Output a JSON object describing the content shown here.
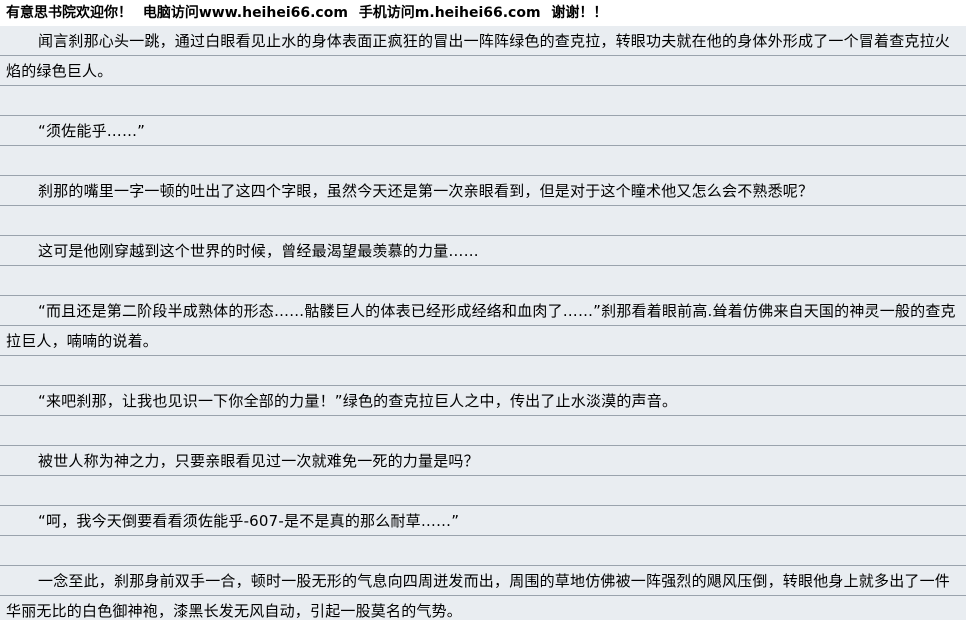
{
  "header": {
    "welcome": "有意思书院欢迎你！",
    "pc_visit": "电脑访问www.heihei66.com",
    "mobile_visit": "手机访问m.heihei66.com",
    "thanks": "谢谢！！"
  },
  "content": {
    "paragraphs": [
      "闻言刹那心头一跳，通过白眼看见止水的身体表面正疯狂的冒出一阵阵绿色的查克拉，转眼功夫就在他的身体外形成了一个冒着查克拉火焰的绿色巨人。",
      "“须佐能乎……”",
      "刹那的嘴里一字一顿的吐出了这四个字眼，虽然今天还是第一次亲眼看到，但是对于这个瞳术他又怎么会不熟悉呢？",
      "这可是他刚穿越到这个世界的时候，曾经最渴望最羡慕的力量……",
      "“而且还是第二阶段半成熟体的形态……骷髅巨人的体表已经形成经络和血肉了……”刹那看着眼前高.耸着仿佛来自天国的神灵一般的查克拉巨人，喃喃的说着。",
      "“来吧刹那，让我也见识一下你全部的力量！”绿色的查克拉巨人之中，传出了止水淡漠的声音。",
      "被世人称为神之力，只要亲眼看见过一次就难免一死的力量是吗？",
      "“呵，我今天倒要看看须佐能乎-607-是不是真的那么耐草……”",
      "一念至此，刹那身前双手一合，顿时一股无形的气息向四周迸发而出，周围的草地仿佛被一阵强烈的飓风压倒，转眼他身上就多出了一件华丽无比的白色御神袍，漆黑长发无风自动，引起一股莫名的气势。"
    ]
  }
}
